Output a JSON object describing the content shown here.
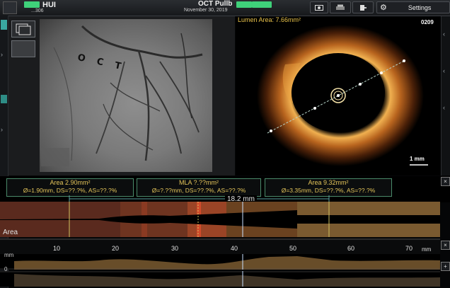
{
  "topbar": {
    "patient_name": "HUI",
    "patient_id": "...306",
    "procedure_title": "OCT Pullb",
    "procedure_date": "November 30, 2019",
    "settings_label": "Settings"
  },
  "angio": {
    "catheter_label": "O C T"
  },
  "oct_view": {
    "lumen_area": "Lumen Area: 7.66mm²",
    "frame_number": "0209",
    "scale_label": "1 mm"
  },
  "measurements": {
    "left": {
      "title": "Area 2.90mm²",
      "values": "Ø=1.90mm, DS=??.?%, AS=??.?%"
    },
    "center": {
      "title": "MLA ?.??mm²",
      "values": "Ø=?.??mm, DS=??.?%, AS=??.?%"
    },
    "right": {
      "title": "Area 9.32mm²",
      "values": "Ø=3.35mm, DS=??.?%, AS=??.?%"
    },
    "distance": "18.2 mm"
  },
  "long_view": {
    "area_label": "Area"
  },
  "ruler": {
    "ticks": [
      "10",
      "20",
      "30",
      "40",
      "50",
      "60",
      "70"
    ],
    "unit": "mm"
  },
  "lumen_profile": {
    "unit_label": "mm",
    "zero_label": "0"
  },
  "colors": {
    "accent": "#e4c55a",
    "tag": "#3fd17a",
    "border_green": "#4a8a6a"
  }
}
